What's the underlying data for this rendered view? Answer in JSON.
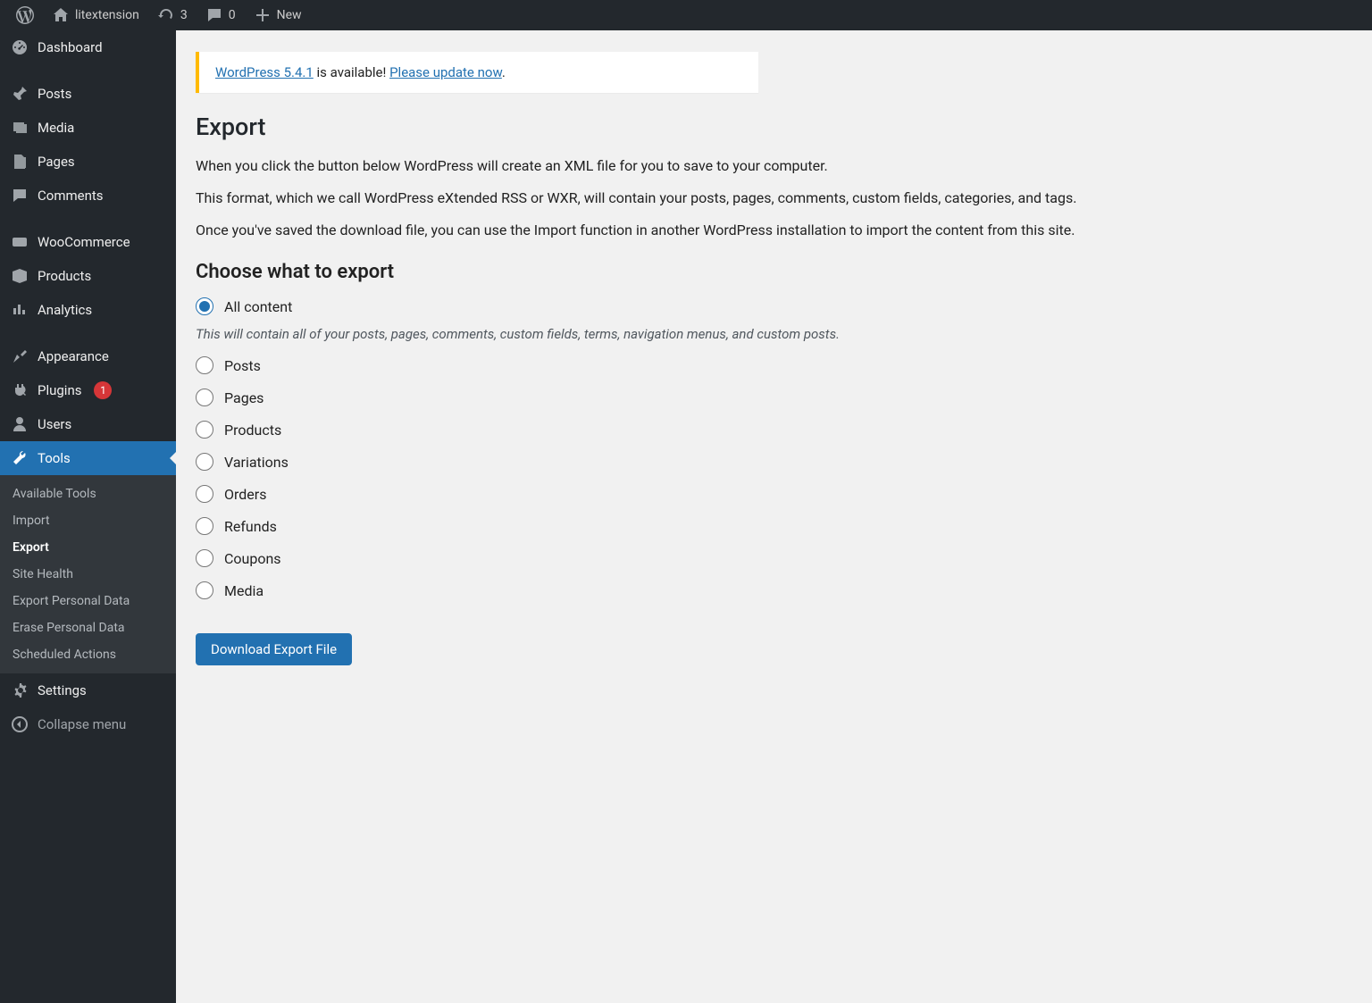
{
  "adminbar": {
    "site_name": "litextension",
    "updates_count": "3",
    "comments_count": "0",
    "new_label": "New"
  },
  "sidebar": {
    "dashboard": "Dashboard",
    "posts": "Posts",
    "media": "Media",
    "pages": "Pages",
    "comments": "Comments",
    "woocommerce": "WooCommerce",
    "products": "Products",
    "analytics": "Analytics",
    "appearance": "Appearance",
    "plugins": "Plugins",
    "plugins_badge": "1",
    "users": "Users",
    "tools": "Tools",
    "settings": "Settings",
    "collapse": "Collapse menu",
    "tools_sub": {
      "available": "Available Tools",
      "import": "Import",
      "export": "Export",
      "site_health": "Site Health",
      "export_pd": "Export Personal Data",
      "erase_pd": "Erase Personal Data",
      "scheduled": "Scheduled Actions"
    }
  },
  "notice": {
    "link1": "WordPress 5.4.1",
    "mid": " is available! ",
    "link2": "Please update now",
    "tail": "."
  },
  "page": {
    "title": "Export",
    "p1": "When you click the button below WordPress will create an XML file for you to save to your computer.",
    "p2": "This format, which we call WordPress eXtended RSS or WXR, will contain your posts, pages, comments, custom fields, categories, and tags.",
    "p3": "Once you've saved the download file, you can use the Import function in another WordPress installation to import the content from this site.",
    "choose": "Choose what to export",
    "all_hint": "This will contain all of your posts, pages, comments, custom fields, terms, navigation menus, and custom posts.",
    "download": "Download Export File"
  },
  "options": {
    "all": "All content",
    "posts": "Posts",
    "pages": "Pages",
    "products": "Products",
    "variations": "Variations",
    "orders": "Orders",
    "refunds": "Refunds",
    "coupons": "Coupons",
    "media": "Media"
  }
}
